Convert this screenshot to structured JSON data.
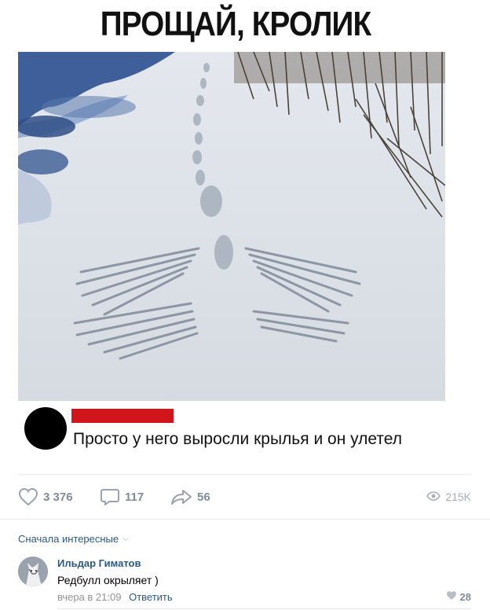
{
  "meme": {
    "title": "ПРОЩАЙ, КРОЛИК",
    "caption": "Просто у него выросли крылья и он улетел"
  },
  "post_actions": {
    "likes": "3 376",
    "comments": "117",
    "shares": "56",
    "views": "215K"
  },
  "comments_section": {
    "sort_label": "Сначала интересные"
  },
  "comment": {
    "author": "Ильдар Гиматов",
    "text": "Редбулл окрыляет )",
    "time": "вчера в 21:09",
    "reply_label": "Ответить",
    "likes": "28"
  },
  "colors": {
    "link": "#2a5885",
    "redaction": "#d1161b",
    "icon_gray": "#99a2ad"
  }
}
